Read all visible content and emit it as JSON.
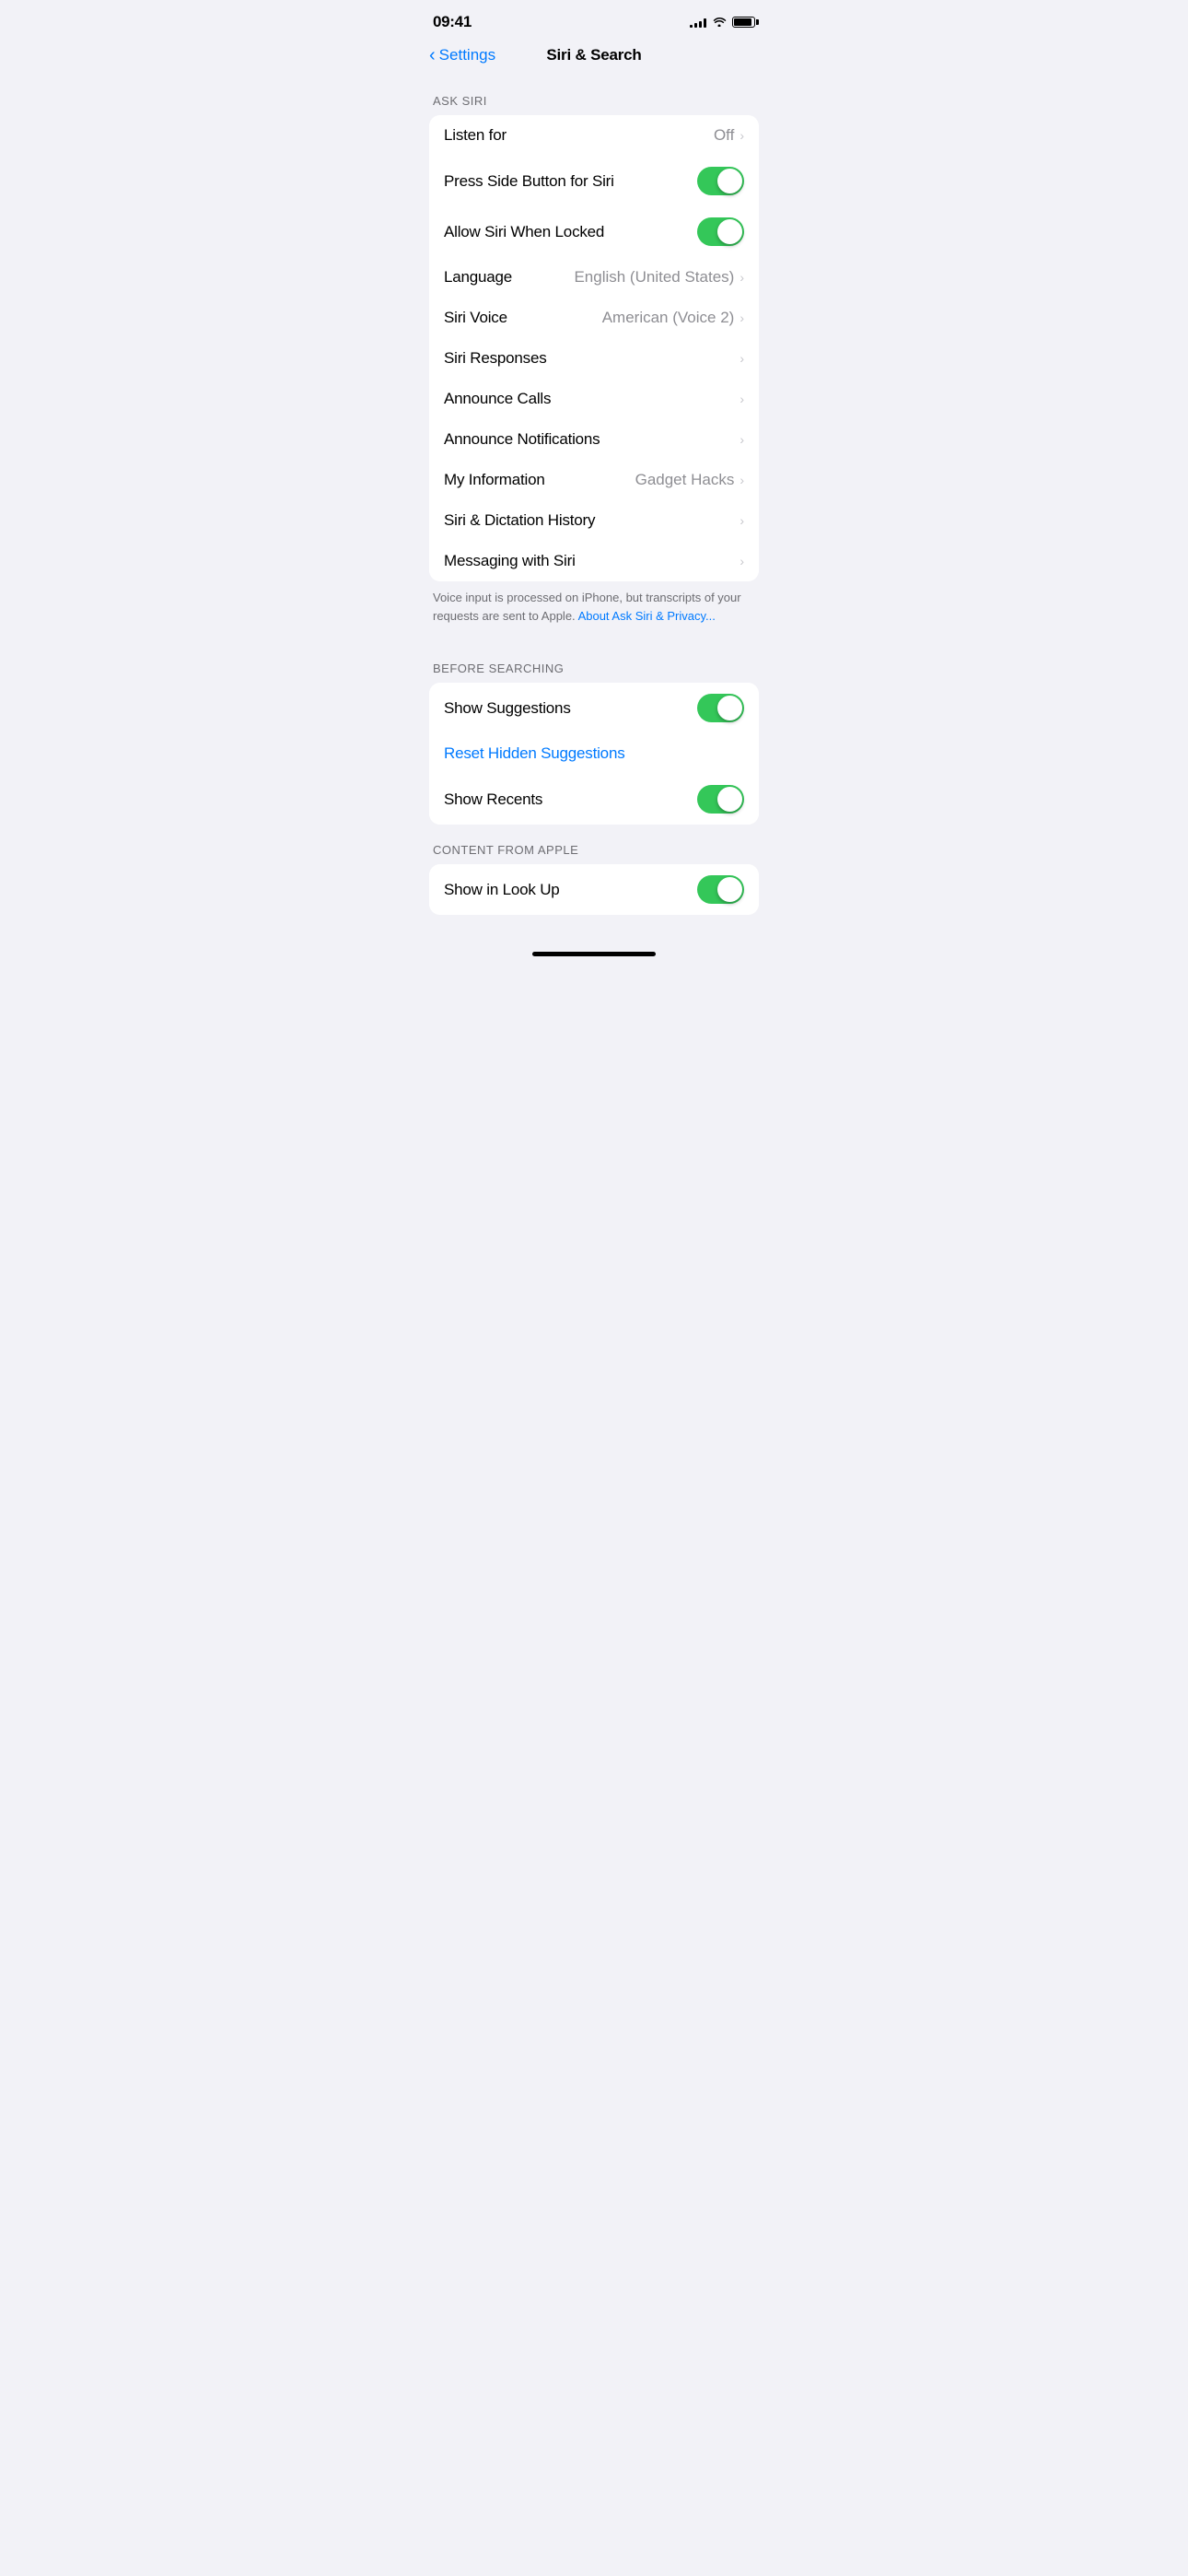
{
  "status_bar": {
    "time": "09:41",
    "signal_label": "Signal",
    "wifi_label": "WiFi",
    "battery_label": "Battery"
  },
  "nav": {
    "back_label": "Settings",
    "title": "Siri & Search"
  },
  "ask_siri_section": {
    "label": "ASK SIRI",
    "rows": [
      {
        "id": "listen-for",
        "label": "Listen for",
        "value": "Off",
        "type": "chevron"
      },
      {
        "id": "press-side-button",
        "label": "Press Side Button for Siri",
        "value": "",
        "type": "toggle",
        "on": true
      },
      {
        "id": "allow-when-locked",
        "label": "Allow Siri When Locked",
        "value": "",
        "type": "toggle",
        "on": true
      },
      {
        "id": "language",
        "label": "Language",
        "value": "English (United States)",
        "type": "chevron"
      },
      {
        "id": "siri-voice",
        "label": "Siri Voice",
        "value": "American (Voice 2)",
        "type": "chevron"
      },
      {
        "id": "siri-responses",
        "label": "Siri Responses",
        "value": "",
        "type": "chevron"
      },
      {
        "id": "announce-calls",
        "label": "Announce Calls",
        "value": "",
        "type": "chevron"
      },
      {
        "id": "announce-notifications",
        "label": "Announce Notifications",
        "value": "",
        "type": "chevron"
      },
      {
        "id": "my-information",
        "label": "My Information",
        "value": "Gadget Hacks",
        "type": "chevron"
      },
      {
        "id": "siri-dictation-history",
        "label": "Siri & Dictation History",
        "value": "",
        "type": "chevron"
      },
      {
        "id": "messaging-with-siri",
        "label": "Messaging with Siri",
        "value": "",
        "type": "chevron"
      }
    ],
    "footer_text": "Voice input is processed on iPhone, but transcripts of your requests are sent to Apple. ",
    "footer_link": "About Ask Siri & Privacy..."
  },
  "before_searching_section": {
    "label": "BEFORE SEARCHING",
    "rows": [
      {
        "id": "show-suggestions",
        "label": "Show Suggestions",
        "value": "",
        "type": "toggle",
        "on": true
      },
      {
        "id": "reset-hidden-suggestions",
        "label": "Reset Hidden Suggestions",
        "value": "",
        "type": "link"
      },
      {
        "id": "show-recents",
        "label": "Show Recents",
        "value": "",
        "type": "toggle",
        "on": true
      }
    ]
  },
  "content_from_apple_section": {
    "label": "CONTENT FROM APPLE",
    "rows": [
      {
        "id": "show-in-look-up",
        "label": "Show in Look Up",
        "value": "",
        "type": "toggle",
        "on": true
      }
    ]
  },
  "home_indicator": true
}
